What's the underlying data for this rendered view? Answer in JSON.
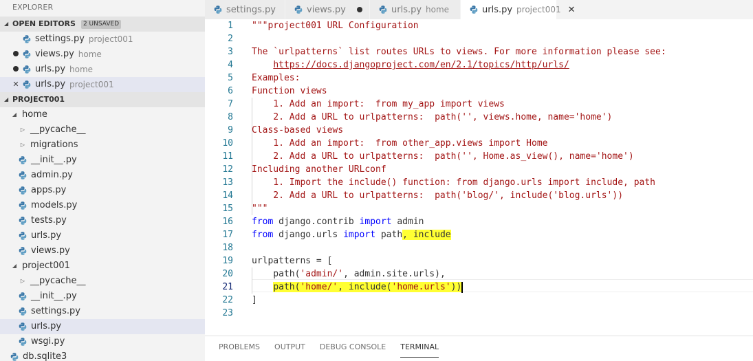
{
  "sidebar": {
    "title": "EXPLORER",
    "open_editors": {
      "label": "OPEN EDITORS",
      "badge": "2 UNSAVED",
      "items": [
        {
          "name": "settings.py",
          "desc": "project001",
          "state": "none"
        },
        {
          "name": "views.py",
          "desc": "home",
          "state": "unsaved"
        },
        {
          "name": "urls.py",
          "desc": "home",
          "state": "unsaved"
        },
        {
          "name": "urls.py",
          "desc": "project001",
          "state": "close",
          "close_glyph": "✕"
        }
      ]
    },
    "project": {
      "label": "PROJECT001",
      "tree": [
        {
          "name": "home",
          "type": "folder-open"
        },
        {
          "name": "__pycache__",
          "type": "folder"
        },
        {
          "name": "migrations",
          "type": "folder"
        },
        {
          "name": "__init__.py",
          "type": "file"
        },
        {
          "name": "admin.py",
          "type": "file"
        },
        {
          "name": "apps.py",
          "type": "file"
        },
        {
          "name": "models.py",
          "type": "file"
        },
        {
          "name": "tests.py",
          "type": "file"
        },
        {
          "name": "urls.py",
          "type": "file"
        },
        {
          "name": "views.py",
          "type": "file"
        },
        {
          "name": "project001",
          "type": "folder-open"
        },
        {
          "name": "__pycache__",
          "type": "folder"
        },
        {
          "name": "__init__.py",
          "type": "file"
        },
        {
          "name": "settings.py",
          "type": "file"
        },
        {
          "name": "urls.py",
          "type": "file",
          "selected": true
        },
        {
          "name": "wsgi.py",
          "type": "file"
        },
        {
          "name": "db.sqlite3",
          "type": "file-db"
        }
      ]
    }
  },
  "tabs": [
    {
      "name": "settings.py",
      "desc": "",
      "state": "none"
    },
    {
      "name": "views.py",
      "desc": "",
      "state": "unsaved"
    },
    {
      "name": "urls.py",
      "desc": "home",
      "state": "unsaved"
    },
    {
      "name": "urls.py",
      "desc": "project001",
      "state": "active",
      "close_glyph": "✕"
    }
  ],
  "editor": {
    "current_line": 21,
    "lines": [
      {
        "n": "1",
        "text": "\"\"\"project001 URL Configuration"
      },
      {
        "n": "2",
        "text": ""
      },
      {
        "n": "3",
        "text": "The `urlpatterns` list routes URLs to views. For more information please see:"
      },
      {
        "n": "4",
        "text": "    https://docs.djangoproject.com/en/2.1/topics/http/urls/"
      },
      {
        "n": "5",
        "text": "Examples:"
      },
      {
        "n": "6",
        "text": "Function views"
      },
      {
        "n": "7",
        "text": "    1. Add an import:  from my_app import views"
      },
      {
        "n": "8",
        "text": "    2. Add a URL to urlpatterns:  path('', views.home, name='home')"
      },
      {
        "n": "9",
        "text": "Class-based views"
      },
      {
        "n": "10",
        "text": "    1. Add an import:  from other_app.views import Home"
      },
      {
        "n": "11",
        "text": "    2. Add a URL to urlpatterns:  path('', Home.as_view(), name='home')"
      },
      {
        "n": "12",
        "text": "Including another URLconf"
      },
      {
        "n": "13",
        "text": "    1. Import the include() function: from django.urls import include, path"
      },
      {
        "n": "14",
        "text": "    2. Add a URL to urlpatterns:  path('blog/', include('blog.urls'))"
      },
      {
        "n": "15",
        "text": "\"\"\""
      },
      {
        "n": "16",
        "text": "from django.contrib import admin"
      },
      {
        "n": "17",
        "text": "from django.urls import path, include"
      },
      {
        "n": "18",
        "text": ""
      },
      {
        "n": "19",
        "text": "urlpatterns = ["
      },
      {
        "n": "20",
        "text": "    path('admin/', admin.site.urls),"
      },
      {
        "n": "21",
        "text": "    path('home/', include('home.urls'))"
      },
      {
        "n": "22",
        "text": "]"
      },
      {
        "n": "23",
        "text": ""
      }
    ],
    "highlights": [
      "line 17: ', include'",
      "line 21: path('home/', include('home.urls'))"
    ],
    "colors": {
      "string": "#a31515",
      "keyword": "#0000ff",
      "line_number": "#237893",
      "highlight": "#ffff33"
    }
  },
  "panel": {
    "tabs": [
      "PROBLEMS",
      "OUTPUT",
      "DEBUG CONSOLE",
      "TERMINAL"
    ],
    "active": "TERMINAL"
  }
}
